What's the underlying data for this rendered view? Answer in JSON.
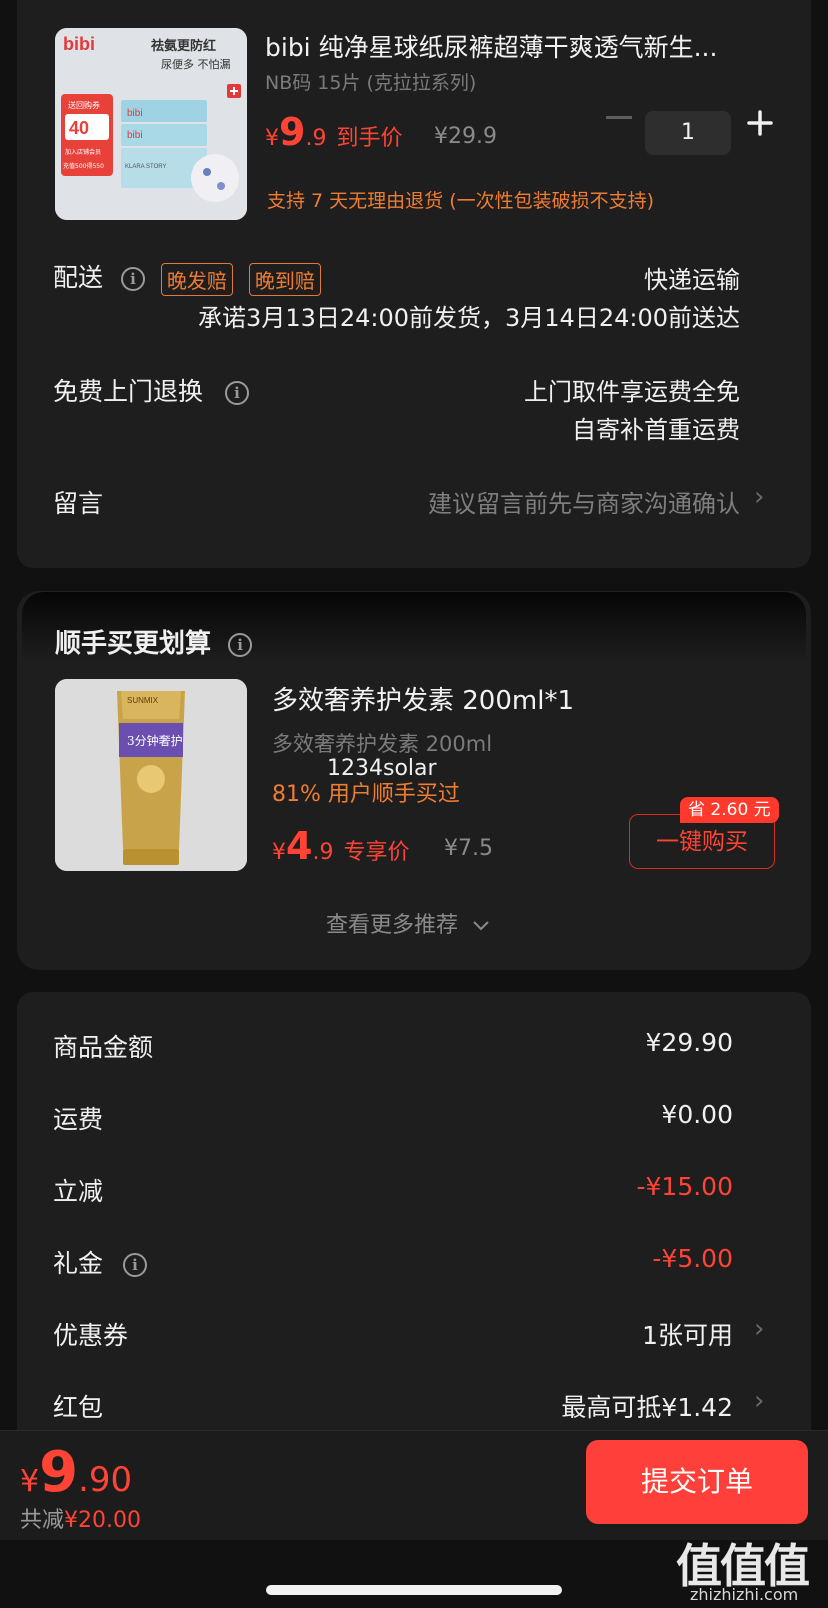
{
  "product": {
    "thumb_text": {
      "brand": "bibi",
      "headline": "祛氨更防红",
      "sub": "尿便多 不怕漏",
      "promo_top": "送回购券",
      "promo_num": "40",
      "promo_small": "加入店铺会员",
      "promo_bottom": "充值500得550",
      "pack": "KLARA STORY"
    },
    "title": "bibi 纯净星球纸尿裤超薄干爽透气新生...",
    "spec": "NB码 15片 (克拉拉系列)",
    "price_symbol": "¥",
    "price_int": "9",
    "price_dec": ".9",
    "price_tag": "到手价",
    "original_price": "¥29.9",
    "quantity": "1",
    "return_policy": "支持 7 天无理由退货 (一次性包装破损不支持)"
  },
  "delivery": {
    "label": "配送",
    "badge_late_ship": "晚发赔",
    "badge_late_arrive": "晚到赔",
    "method": "快递运输",
    "promise": "承诺3月13日24:00前发货，3月14日24:00前送达"
  },
  "returns": {
    "label": "免费上门退换",
    "line1": "上门取件享运费全免",
    "line2": "自寄补首重运费"
  },
  "message": {
    "label": "留言",
    "placeholder": "建议留言前先与商家沟通确认"
  },
  "addon": {
    "section_title": "顺手买更划算",
    "thumb_text": {
      "label": "3分钟奢护",
      "brand": "SUNMIX"
    },
    "title": "多效奢养护发素 200ml*1",
    "spec": "多效奢养护发素 200ml",
    "watermark": "1234solar",
    "social": "81% 用户顺手买过",
    "price_symbol": "¥",
    "price_int": "4",
    "price_dec": ".9",
    "price_tag": "专享价",
    "original_price": "¥7.5",
    "save_tag": "省 2.60 元",
    "buy_label": "一键购买",
    "more_label": "查看更多推荐"
  },
  "summary": {
    "rows": [
      {
        "label": "商品金额",
        "value": "¥29.90",
        "color": "#f0f0f0"
      },
      {
        "label": "运费",
        "value": "¥0.00",
        "color": "#f0f0f0"
      },
      {
        "label": "立减",
        "value": "-¥15.00",
        "color": "#ff4335"
      },
      {
        "label": "礼金",
        "value": "-¥5.00",
        "color": "#ff4335"
      },
      {
        "label": "优惠券",
        "value": "1张可用",
        "color": "#f0f0f0"
      },
      {
        "label": "红包",
        "value": "最高可抵¥1.42",
        "color": "#f0f0f0"
      }
    ]
  },
  "footer": {
    "total_symbol": "¥",
    "total_int": "9",
    "total_dec": ".90",
    "saved_label": "共减",
    "saved_value": "¥20.00",
    "submit_label": "提交订单"
  },
  "watermark": {
    "logo": "值值值",
    "url": "zhizhizhi.com"
  },
  "colors": {
    "accent": "#ff4335",
    "orange": "#ef7c33",
    "card": "#1e1e1e",
    "background": "#111111"
  }
}
